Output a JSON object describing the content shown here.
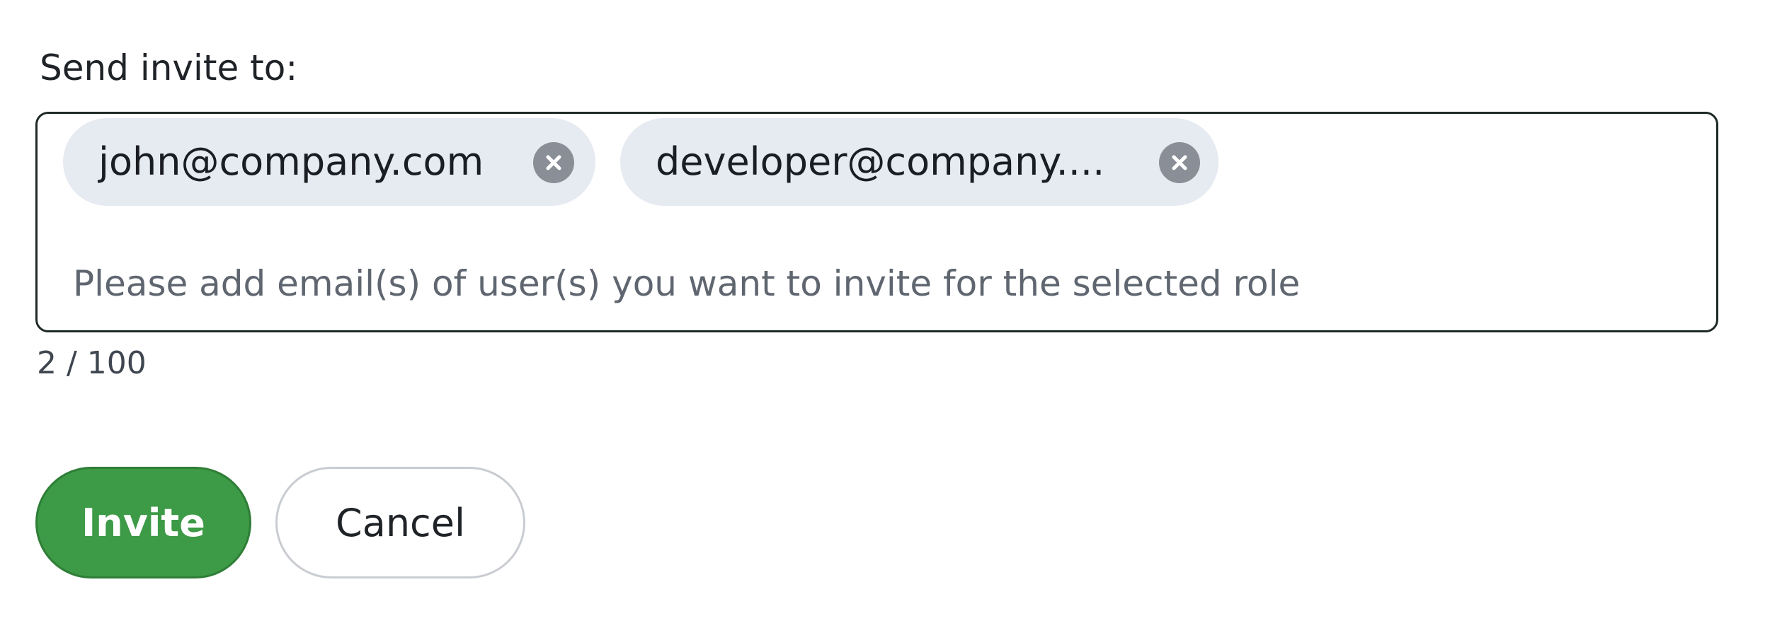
{
  "form": {
    "label": "Send invite to:",
    "chips": [
      {
        "email": "john@company.com",
        "remove_icon": "close-circle-icon"
      },
      {
        "email": "developer@company....",
        "remove_icon": "close-circle-icon"
      }
    ],
    "placeholder": "Please add email(s) of user(s) you want to invite for the selected role",
    "counter": "2 / 100"
  },
  "actions": {
    "invite_label": "Invite",
    "cancel_label": "Cancel"
  },
  "colors": {
    "invite_bg": "#3d9a46",
    "chip_bg": "#e6eaf1",
    "chip_close": "#8a8f97",
    "field_border": "#1f2a24"
  }
}
